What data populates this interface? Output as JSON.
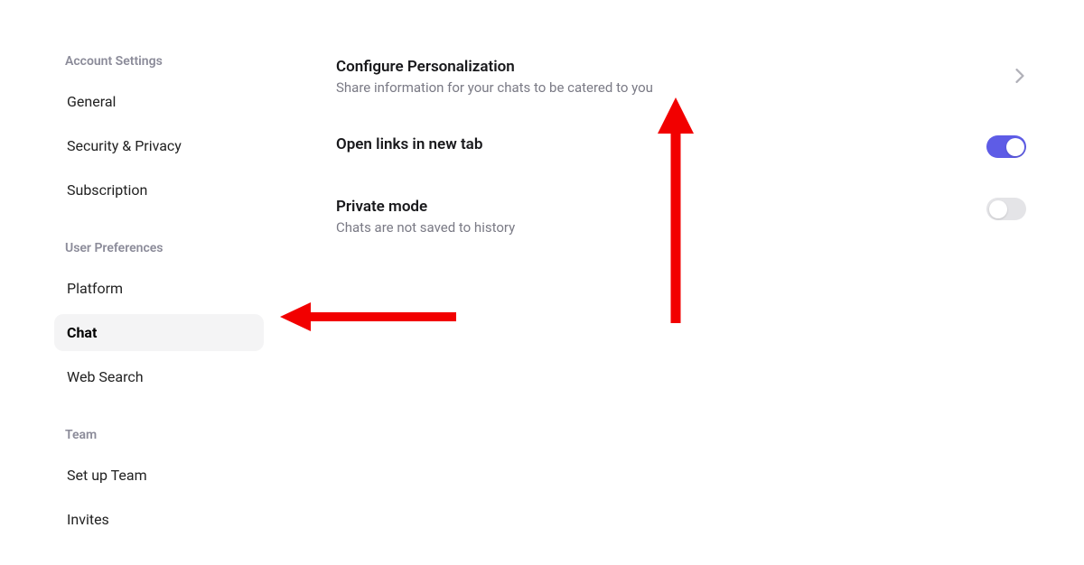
{
  "sidebar": {
    "sections": [
      {
        "heading": "Account Settings",
        "items": [
          {
            "label": "General",
            "active": false
          },
          {
            "label": "Security & Privacy",
            "active": false
          },
          {
            "label": "Subscription",
            "active": false
          }
        ]
      },
      {
        "heading": "User Preferences",
        "items": [
          {
            "label": "Platform",
            "active": false
          },
          {
            "label": "Chat",
            "active": true
          },
          {
            "label": "Web Search",
            "active": false
          }
        ]
      },
      {
        "heading": "Team",
        "items": [
          {
            "label": "Set up Team",
            "active": false
          },
          {
            "label": "Invites",
            "active": false
          }
        ]
      }
    ]
  },
  "settings": {
    "personalization": {
      "title": "Configure Personalization",
      "subtitle": "Share information for your chats to be catered to you"
    },
    "open_links": {
      "title": "Open links in new tab",
      "enabled": true
    },
    "private_mode": {
      "title": "Private mode",
      "subtitle": "Chats are not saved to history",
      "enabled": false
    }
  },
  "annotations": {
    "arrow_color": "#f20000"
  }
}
